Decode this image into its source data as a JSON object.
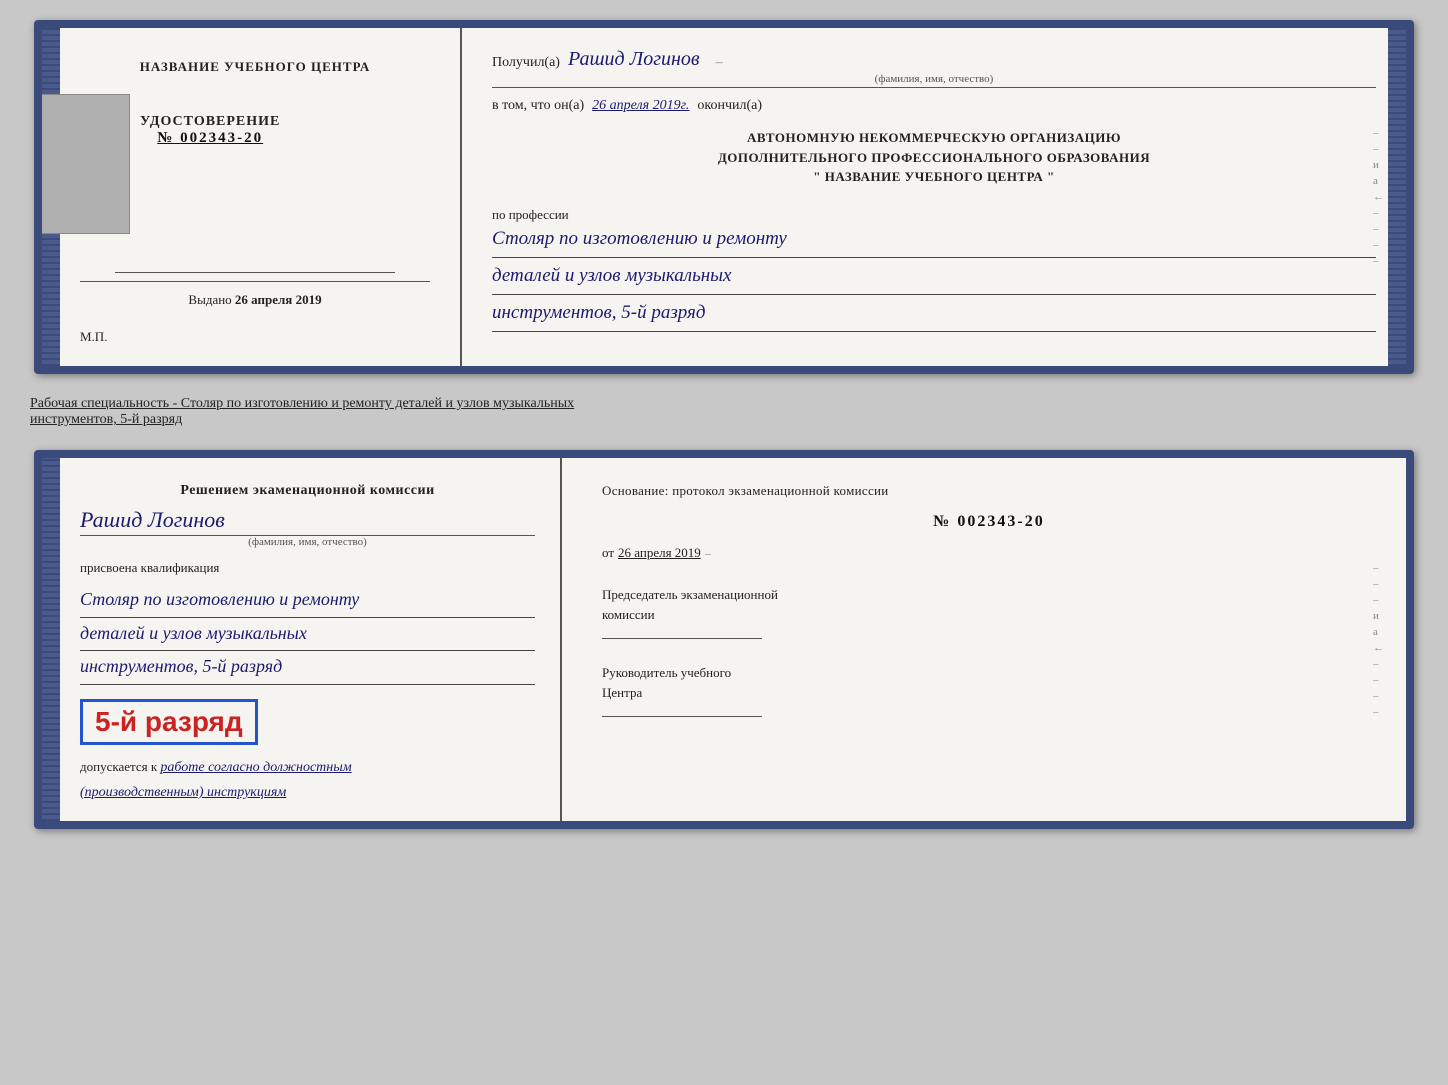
{
  "top_card": {
    "left": {
      "title": "НАЗВАНИЕ УЧЕБНОГО ЦЕНТРА",
      "cert_label": "УДОСТОВЕРЕНИЕ",
      "cert_number_prefix": "№",
      "cert_number": "002343-20",
      "issued_label": "Выдано",
      "issued_date": "26 апреля 2019",
      "mp": "М.П."
    },
    "right": {
      "recipient_prefix": "Получил(а)",
      "recipient_name": "Рашид Логинов",
      "recipient_subtitle": "(фамилия, имя, отчество)",
      "statement_prefix": "в том, что он(а)",
      "statement_date": "26 апреля 2019г.",
      "statement_suffix": "окончил(а)",
      "org_line1": "АВТОНОМНУЮ НЕКОММЕРЧЕСКУЮ ОРГАНИЗАЦИЮ",
      "org_line2": "ДОПОЛНИТЕЛЬНОГО ПРОФЕССИОНАЛЬНОГО ОБРАЗОВАНИЯ",
      "org_line3": "\"    НАЗВАНИЕ УЧЕБНОГО ЦЕНТРА    \"",
      "profession_label": "по профессии",
      "profession_line1": "Столяр по изготовлению и ремонту",
      "profession_line2": "деталей и узлов музыкальных",
      "profession_line3": "инструментов, 5-й разряд"
    }
  },
  "separator": {
    "text_prefix": "Рабочая специальность - Столяр по изготовлению и ремонту деталей и узлов музыкальных",
    "text_underlined": "инструментов, 5-й разряд"
  },
  "bottom_card": {
    "left": {
      "decision_header": "Решением экаменационной комиссии",
      "name": "Рашид Логинов",
      "name_subtitle": "(фамилия, имя, отчество)",
      "assigned_label": "присвоена квалификация",
      "qualification_line1": "Столяр по изготовлению и ремонту",
      "qualification_line2": "деталей и узлов музыкальных",
      "qualification_line3": "инструментов, 5-й разряд",
      "rank_badge_text": "5-й разряд",
      "допускается_prefix": "допускается к",
      "допускается_handwritten": "работе согласно должностным",
      "допускается_suffix": "(производственным) инструкциям"
    },
    "right": {
      "osnov_label": "Основание: протокол экзаменационной комиссии",
      "protocol_number": "№  002343-20",
      "protocol_date_prefix": "от",
      "protocol_date": "26 апреля 2019",
      "chairman_label": "Председатель экзаменационной\nкомиссии",
      "head_label": "Руководитель учебного\nЦентра"
    }
  }
}
